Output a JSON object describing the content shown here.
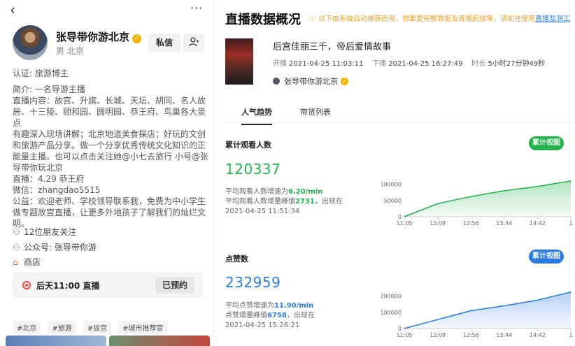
{
  "profile": {
    "back": "‹",
    "more": "···",
    "name": "张导带你游北京",
    "verified_mark": "✓",
    "gender_location": "男  北京",
    "message_button": "私信",
    "follow_icon": "user-add-icon",
    "certification": "认证: 旅游博主",
    "bio_lines": [
      "简介: 一名导游主播",
      "直播内容：故宫、升旗、长城、天坛、胡同、名人故",
      "居、十三陵、颐和园、圆明园、恭王府、鸟巢各大景点",
      "有趣深入现场讲解；北京地道美食探店；好玩的文创",
      "和旅游产品分享。做一个分享优秀传统文化知识的正",
      "能量主播。也可以点击关注她@小七去旅行 小号@张",
      "导带你玩北京",
      "直播：4.29 恭王府",
      "微信：zhangdao5515",
      "公益：欢迎老师、学校领导联系我，免费为中小学生",
      "做专题故宫直播，让更多外地孩子了解我们的灿烂文",
      "明。"
    ],
    "friends_following": "12位朋友关注",
    "official_account": "公众号: 张导带你游",
    "shop": "商店",
    "live_schedule": "后天11:00 直播",
    "reserved_button": "已预约",
    "tags": [
      "#北京",
      "#旅游",
      "#故宫",
      "#城市推荐官"
    ]
  },
  "overview": {
    "title": "直播数据概况",
    "notice": "ⓘ 以下由系统自动捕获而得，想要更完整数据及直播回放等，请前往使用",
    "notice_link": "直播监测工",
    "session_title": "后宫佳丽三千，帝后爱情故事",
    "start_label": "开播",
    "start_time": "2021-04-25 11:03:11",
    "end_label": "下播",
    "end_time": "2021-04-25 16:27:49",
    "duration_label": "时长",
    "duration": "5小时27分钟49秒",
    "host": "张导带你游北京",
    "tabs": [
      "人气趋势",
      "带货列表"
    ],
    "colors": {
      "green": "#21b24a",
      "blue": "#2a7ae2"
    }
  },
  "viewers": {
    "title": "累计观看人数",
    "button": "累计视图",
    "total": "120337",
    "line1_prefix": "平均观看人数增速为",
    "line1_value": "6.20/min",
    "line2_prefix": "平均观看人数增量峰值",
    "line2_value": "2731",
    "line2_suffix": "，出现在",
    "line3": "2021-04-25 11:51:34"
  },
  "likes": {
    "title": "点赞数",
    "button": "累计视图",
    "total": "232959",
    "line1_prefix": "平均点赞增速为",
    "line1_value": "11.90/min",
    "line2_prefix": "点赞增量峰值",
    "line2_value": "6758",
    "line2_suffix": "，出现在",
    "line3": "2021-04-25 15:26:21"
  },
  "chart_data": [
    {
      "type": "area",
      "title": "",
      "xlabel": "",
      "ylabel": "",
      "x_ticks": [
        "11:05",
        "12:08",
        "12:56",
        "13:44",
        "14:42",
        "1"
      ],
      "y_ticks": [
        0,
        50000,
        100000
      ],
      "ylim": [
        0,
        125000
      ],
      "x": [
        "11:05",
        "12:08",
        "12:56",
        "13:44",
        "14:42",
        "1"
      ],
      "values": [
        0,
        40000,
        62000,
        80000,
        93000,
        110000
      ],
      "color": "#21b24a",
      "grid": false
    },
    {
      "type": "area",
      "title": "",
      "xlabel": "",
      "ylabel": "",
      "x_ticks": [
        "11:05",
        "12:08",
        "12:56",
        "13:44",
        "14:42",
        "1"
      ],
      "y_ticks": [
        0,
        100000,
        200000
      ],
      "ylim": [
        0,
        250000
      ],
      "x": [
        "11:05",
        "12:08",
        "12:56",
        "13:44",
        "14:42",
        "1"
      ],
      "values": [
        0,
        55000,
        110000,
        140000,
        175000,
        225000
      ],
      "color": "#2a7ae2",
      "grid": false
    }
  ]
}
